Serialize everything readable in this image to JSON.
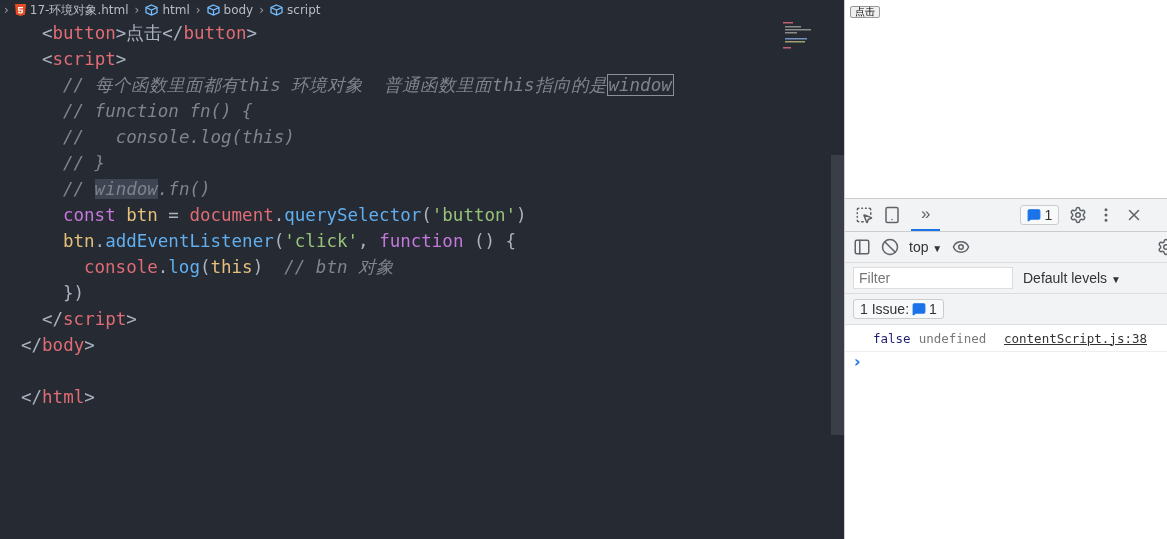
{
  "breadcrumb": {
    "separator": "›",
    "items": [
      {
        "kind": "file",
        "label": "17-环境对象.html"
      },
      {
        "kind": "element",
        "label": "html"
      },
      {
        "kind": "element",
        "label": "body"
      },
      {
        "kind": "element",
        "label": "script"
      }
    ]
  },
  "code_lines": [
    {
      "children": [
        {
          "tokens": [
            {
              "kind": "punct",
              "text": "<"
            },
            {
              "kind": "tag",
              "text": "button"
            },
            {
              "kind": "punct",
              "text": ">"
            },
            {
              "kind": "plain",
              "text": "点击"
            },
            {
              "kind": "punct",
              "text": "</"
            },
            {
              "kind": "tag",
              "text": "button"
            },
            {
              "kind": "punct",
              "text": ">"
            }
          ]
        },
        {
          "tokens": [
            {
              "kind": "punct",
              "text": "<"
            },
            {
              "kind": "tag",
              "text": "script"
            },
            {
              "kind": "punct",
              "text": ">"
            }
          ],
          "children": [
            {
              "tokens": [
                {
                  "kind": "comment",
                  "text": "// 每个函数里面都有this 环境对象  普通函数里面this指向的是"
                },
                {
                  "kind": "boxed",
                  "text": "window"
                }
              ]
            },
            {
              "tokens": [
                {
                  "kind": "comment",
                  "text": "// function fn() {"
                }
              ]
            },
            {
              "tokens": [
                {
                  "kind": "comment",
                  "text": "//   console.log(this)"
                }
              ]
            },
            {
              "tokens": [
                {
                  "kind": "comment",
                  "text": "// }"
                }
              ]
            },
            {
              "tokens": [
                {
                  "kind": "comment",
                  "text": "// "
                },
                {
                  "kind": "selected",
                  "text": "window"
                },
                {
                  "kind": "comment",
                  "text": ".fn()"
                }
              ]
            },
            {
              "tokens": [
                {
                  "kind": "keyword",
                  "text": "const "
                },
                {
                  "kind": "var",
                  "text": "btn"
                },
                {
                  "kind": "plain",
                  "text": " = "
                },
                {
                  "kind": "object",
                  "text": "document"
                },
                {
                  "kind": "plain",
                  "text": "."
                },
                {
                  "kind": "fn",
                  "text": "querySelector"
                },
                {
                  "kind": "plain",
                  "text": "("
                },
                {
                  "kind": "string",
                  "text": "'button'"
                },
                {
                  "kind": "plain",
                  "text": ")"
                }
              ]
            },
            {
              "tokens": [
                {
                  "kind": "var",
                  "text": "btn"
                },
                {
                  "kind": "plain",
                  "text": "."
                },
                {
                  "kind": "fn",
                  "text": "addEventListener"
                },
                {
                  "kind": "plain",
                  "text": "("
                },
                {
                  "kind": "string",
                  "text": "'click'"
                },
                {
                  "kind": "plain",
                  "text": ", "
                },
                {
                  "kind": "keyword",
                  "text": "function"
                },
                {
                  "kind": "plain",
                  "text": " () {"
                }
              ],
              "children": [
                {
                  "tokens": [
                    {
                      "kind": "object",
                      "text": "console"
                    },
                    {
                      "kind": "plain",
                      "text": "."
                    },
                    {
                      "kind": "fn",
                      "text": "log"
                    },
                    {
                      "kind": "plain",
                      "text": "("
                    },
                    {
                      "kind": "var",
                      "text": "this"
                    },
                    {
                      "kind": "plain",
                      "text": ")  "
                    },
                    {
                      "kind": "comment",
                      "text": "// btn 对象"
                    }
                  ]
                }
              ]
            },
            {
              "tokens": [
                {
                  "kind": "plain",
                  "text": "})"
                }
              ]
            }
          ]
        },
        {
          "tokens": [
            {
              "kind": "punct",
              "text": "</"
            },
            {
              "kind": "tag",
              "text": "script"
            },
            {
              "kind": "punct",
              "text": ">"
            }
          ]
        }
      ]
    },
    {
      "tokens": [
        {
          "kind": "punct",
          "text": "</"
        },
        {
          "kind": "tag",
          "text": "body"
        },
        {
          "kind": "punct",
          "text": ">"
        }
      ]
    },
    {
      "kind": "blank"
    },
    {
      "tokens": [
        {
          "kind": "punct",
          "text": "</"
        },
        {
          "kind": "tag",
          "text": "html"
        },
        {
          "kind": "punct",
          "text": ">"
        }
      ]
    }
  ],
  "preview": {
    "button": "点击"
  },
  "devtools": {
    "tab_more": "»",
    "issue_count": "1",
    "context": "top",
    "context_arrow": "▼",
    "filter": {
      "placeholder": "Filter"
    },
    "levels": "Default levels",
    "levels_arrow": "▼",
    "issues_label": "1 Issue:",
    "issues_count": "1",
    "messages": [
      {
        "parts": [
          {
            "kind": "boolean",
            "text": "false"
          },
          {
            "kind": "undefined",
            "text": "undefined"
          }
        ],
        "source": "contentScript.js:38"
      }
    ],
    "prompt": "›"
  }
}
